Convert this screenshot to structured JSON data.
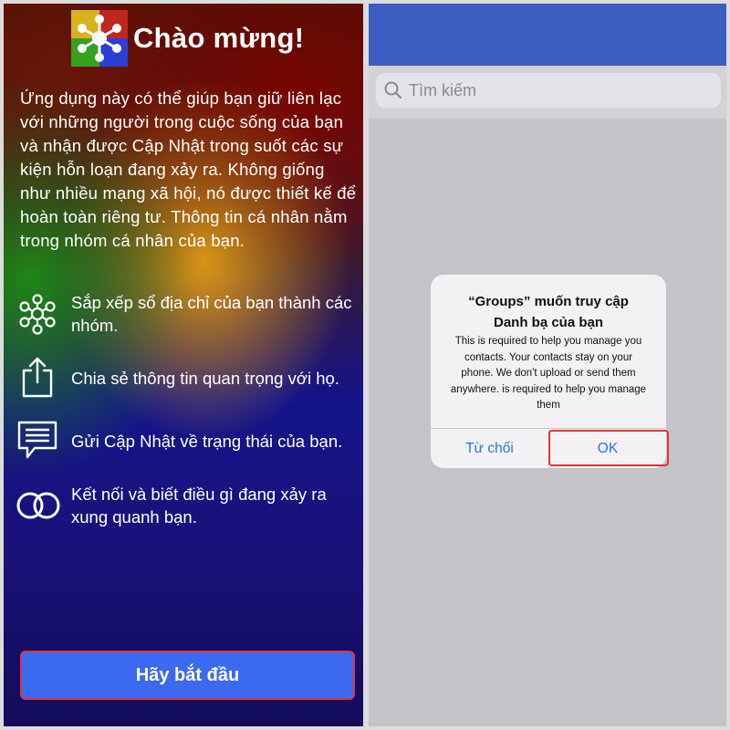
{
  "left": {
    "title": "Chào mừng!",
    "intro": "Ứng dụng này có thể giúp bạn giữ liên lạc với những người trong cuộc sống của bạn và nhận được Cập Nhật trong suốt các sự kiện hỗn loạn đang xảy ra. Không giống như nhiều mạng xã hội, nó được thiết kế để hoàn toàn riêng tư. Thông tin cá nhân nằm trong nhóm cá nhân của bạn.",
    "features": [
      {
        "icon": "network-icon",
        "text": "Sắp xếp sổ địa chỉ của bạn thành các nhóm."
      },
      {
        "icon": "share-icon",
        "text": "Chia sẻ thông tin quan trọng với họ."
      },
      {
        "icon": "message-icon",
        "text": "Gửi Cập Nhật về trạng thái của bạn."
      },
      {
        "icon": "rings-icon",
        "text": "Kết nối và biết điều gì đang xảy ra xung quanh bạn."
      }
    ],
    "start_button": "Hãy bắt đầu"
  },
  "right": {
    "search_placeholder": "Tìm kiếm",
    "dialog": {
      "title": "“Groups” muốn truy cập Danh bạ của bạn",
      "body": "This is required to help you manage you contacts. Your contacts stay on your phone. We don't upload or send them anywhere. is required to help you manage them",
      "deny_label": "Từ chối",
      "ok_label": "OK"
    }
  },
  "colors": {
    "accent_blue": "#3b6af0",
    "highlight_red": "#e0343a",
    "ios_link_blue": "#2b73e8",
    "nav_blue": "#3d5cc2"
  }
}
